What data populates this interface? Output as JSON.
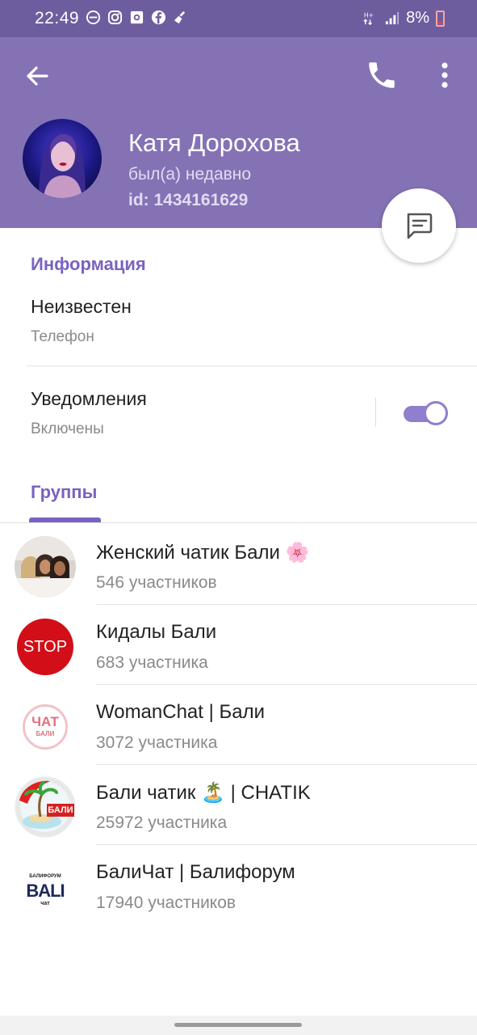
{
  "status_bar": {
    "time": "22:49",
    "battery": "8%",
    "icons": [
      "do-not-disturb-icon",
      "instagram-icon",
      "camera-icon",
      "facebook-icon",
      "broom-icon",
      "signal-icon",
      "battery-icon"
    ]
  },
  "header": {
    "name": "Катя Дорохова",
    "status": "был(а) недавно",
    "id": "id: 1434161629",
    "accent_color": "#8472b5"
  },
  "info": {
    "section_title": "Информация",
    "phone_value": "Неизвестен",
    "phone_label": "Телефон",
    "notifications_title": "Уведомления",
    "notifications_state": "Включены",
    "notifications_enabled": true
  },
  "groups": {
    "section_title": "Группы",
    "items": [
      {
        "name": "Женский чатик Бали 🌸",
        "count": "546 участников"
      },
      {
        "name": "Кидалы Бали",
        "count": "683 участника",
        "avatar_text": "STOP"
      },
      {
        "name": "WomanChat | Бали",
        "count": "3072 участника",
        "avatar_text": "ЧАТ",
        "avatar_sub": "БАЛИ"
      },
      {
        "name": "Бали чатик 🏝️ | CHATIK",
        "count": "25972 участника",
        "avatar_text": "БАЛИ"
      },
      {
        "name": "БалиЧат | Балифорум",
        "count": "17940 участников",
        "avatar_top": "БАЛИФОРУМ",
        "avatar_text": "BALI",
        "avatar_sub": "чат"
      }
    ]
  }
}
